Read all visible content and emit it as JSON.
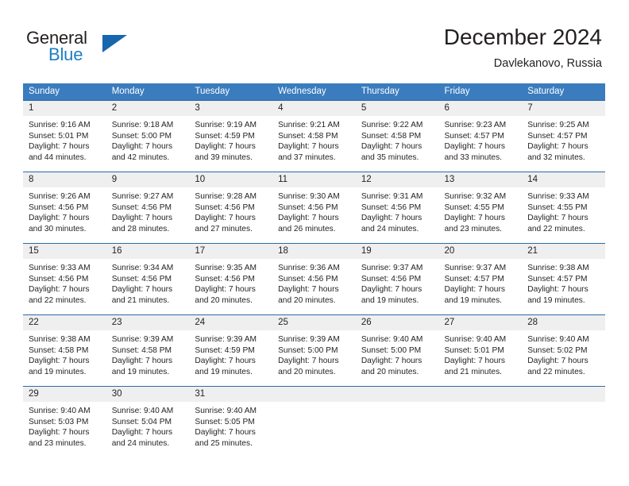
{
  "brand": {
    "name_top": "General",
    "name_bottom": "Blue",
    "triangle_icon": "blue-triangle-icon",
    "color_dark": "#231f20",
    "color_blue": "#1c7fc4"
  },
  "header": {
    "title": "December 2024",
    "subtitle": "Davlekanovo, Russia"
  },
  "theme": {
    "header_bg": "#3a7cbe",
    "header_text": "#ffffff",
    "row_divider": "#2a6ba8",
    "daynum_bg": "#efefef",
    "body_text": "#231f20"
  },
  "weekday_headers": [
    "Sunday",
    "Monday",
    "Tuesday",
    "Wednesday",
    "Thursday",
    "Friday",
    "Saturday"
  ],
  "weeks": [
    [
      {
        "day": "1",
        "sunrise": "Sunrise: 9:16 AM",
        "sunset": "Sunset: 5:01 PM",
        "daylight_1": "Daylight: 7 hours",
        "daylight_2": "and 44 minutes."
      },
      {
        "day": "2",
        "sunrise": "Sunrise: 9:18 AM",
        "sunset": "Sunset: 5:00 PM",
        "daylight_1": "Daylight: 7 hours",
        "daylight_2": "and 42 minutes."
      },
      {
        "day": "3",
        "sunrise": "Sunrise: 9:19 AM",
        "sunset": "Sunset: 4:59 PM",
        "daylight_1": "Daylight: 7 hours",
        "daylight_2": "and 39 minutes."
      },
      {
        "day": "4",
        "sunrise": "Sunrise: 9:21 AM",
        "sunset": "Sunset: 4:58 PM",
        "daylight_1": "Daylight: 7 hours",
        "daylight_2": "and 37 minutes."
      },
      {
        "day": "5",
        "sunrise": "Sunrise: 9:22 AM",
        "sunset": "Sunset: 4:58 PM",
        "daylight_1": "Daylight: 7 hours",
        "daylight_2": "and 35 minutes."
      },
      {
        "day": "6",
        "sunrise": "Sunrise: 9:23 AM",
        "sunset": "Sunset: 4:57 PM",
        "daylight_1": "Daylight: 7 hours",
        "daylight_2": "and 33 minutes."
      },
      {
        "day": "7",
        "sunrise": "Sunrise: 9:25 AM",
        "sunset": "Sunset: 4:57 PM",
        "daylight_1": "Daylight: 7 hours",
        "daylight_2": "and 32 minutes."
      }
    ],
    [
      {
        "day": "8",
        "sunrise": "Sunrise: 9:26 AM",
        "sunset": "Sunset: 4:56 PM",
        "daylight_1": "Daylight: 7 hours",
        "daylight_2": "and 30 minutes."
      },
      {
        "day": "9",
        "sunrise": "Sunrise: 9:27 AM",
        "sunset": "Sunset: 4:56 PM",
        "daylight_1": "Daylight: 7 hours",
        "daylight_2": "and 28 minutes."
      },
      {
        "day": "10",
        "sunrise": "Sunrise: 9:28 AM",
        "sunset": "Sunset: 4:56 PM",
        "daylight_1": "Daylight: 7 hours",
        "daylight_2": "and 27 minutes."
      },
      {
        "day": "11",
        "sunrise": "Sunrise: 9:30 AM",
        "sunset": "Sunset: 4:56 PM",
        "daylight_1": "Daylight: 7 hours",
        "daylight_2": "and 26 minutes."
      },
      {
        "day": "12",
        "sunrise": "Sunrise: 9:31 AM",
        "sunset": "Sunset: 4:56 PM",
        "daylight_1": "Daylight: 7 hours",
        "daylight_2": "and 24 minutes."
      },
      {
        "day": "13",
        "sunrise": "Sunrise: 9:32 AM",
        "sunset": "Sunset: 4:55 PM",
        "daylight_1": "Daylight: 7 hours",
        "daylight_2": "and 23 minutes."
      },
      {
        "day": "14",
        "sunrise": "Sunrise: 9:33 AM",
        "sunset": "Sunset: 4:55 PM",
        "daylight_1": "Daylight: 7 hours",
        "daylight_2": "and 22 minutes."
      }
    ],
    [
      {
        "day": "15",
        "sunrise": "Sunrise: 9:33 AM",
        "sunset": "Sunset: 4:56 PM",
        "daylight_1": "Daylight: 7 hours",
        "daylight_2": "and 22 minutes."
      },
      {
        "day": "16",
        "sunrise": "Sunrise: 9:34 AM",
        "sunset": "Sunset: 4:56 PM",
        "daylight_1": "Daylight: 7 hours",
        "daylight_2": "and 21 minutes."
      },
      {
        "day": "17",
        "sunrise": "Sunrise: 9:35 AM",
        "sunset": "Sunset: 4:56 PM",
        "daylight_1": "Daylight: 7 hours",
        "daylight_2": "and 20 minutes."
      },
      {
        "day": "18",
        "sunrise": "Sunrise: 9:36 AM",
        "sunset": "Sunset: 4:56 PM",
        "daylight_1": "Daylight: 7 hours",
        "daylight_2": "and 20 minutes."
      },
      {
        "day": "19",
        "sunrise": "Sunrise: 9:37 AM",
        "sunset": "Sunset: 4:56 PM",
        "daylight_1": "Daylight: 7 hours",
        "daylight_2": "and 19 minutes."
      },
      {
        "day": "20",
        "sunrise": "Sunrise: 9:37 AM",
        "sunset": "Sunset: 4:57 PM",
        "daylight_1": "Daylight: 7 hours",
        "daylight_2": "and 19 minutes."
      },
      {
        "day": "21",
        "sunrise": "Sunrise: 9:38 AM",
        "sunset": "Sunset: 4:57 PM",
        "daylight_1": "Daylight: 7 hours",
        "daylight_2": "and 19 minutes."
      }
    ],
    [
      {
        "day": "22",
        "sunrise": "Sunrise: 9:38 AM",
        "sunset": "Sunset: 4:58 PM",
        "daylight_1": "Daylight: 7 hours",
        "daylight_2": "and 19 minutes."
      },
      {
        "day": "23",
        "sunrise": "Sunrise: 9:39 AM",
        "sunset": "Sunset: 4:58 PM",
        "daylight_1": "Daylight: 7 hours",
        "daylight_2": "and 19 minutes."
      },
      {
        "day": "24",
        "sunrise": "Sunrise: 9:39 AM",
        "sunset": "Sunset: 4:59 PM",
        "daylight_1": "Daylight: 7 hours",
        "daylight_2": "and 19 minutes."
      },
      {
        "day": "25",
        "sunrise": "Sunrise: 9:39 AM",
        "sunset": "Sunset: 5:00 PM",
        "daylight_1": "Daylight: 7 hours",
        "daylight_2": "and 20 minutes."
      },
      {
        "day": "26",
        "sunrise": "Sunrise: 9:40 AM",
        "sunset": "Sunset: 5:00 PM",
        "daylight_1": "Daylight: 7 hours",
        "daylight_2": "and 20 minutes."
      },
      {
        "day": "27",
        "sunrise": "Sunrise: 9:40 AM",
        "sunset": "Sunset: 5:01 PM",
        "daylight_1": "Daylight: 7 hours",
        "daylight_2": "and 21 minutes."
      },
      {
        "day": "28",
        "sunrise": "Sunrise: 9:40 AM",
        "sunset": "Sunset: 5:02 PM",
        "daylight_1": "Daylight: 7 hours",
        "daylight_2": "and 22 minutes."
      }
    ],
    [
      {
        "day": "29",
        "sunrise": "Sunrise: 9:40 AM",
        "sunset": "Sunset: 5:03 PM",
        "daylight_1": "Daylight: 7 hours",
        "daylight_2": "and 23 minutes."
      },
      {
        "day": "30",
        "sunrise": "Sunrise: 9:40 AM",
        "sunset": "Sunset: 5:04 PM",
        "daylight_1": "Daylight: 7 hours",
        "daylight_2": "and 24 minutes."
      },
      {
        "day": "31",
        "sunrise": "Sunrise: 9:40 AM",
        "sunset": "Sunset: 5:05 PM",
        "daylight_1": "Daylight: 7 hours",
        "daylight_2": "and 25 minutes."
      },
      {
        "day": "",
        "sunrise": "",
        "sunset": "",
        "daylight_1": "",
        "daylight_2": ""
      },
      {
        "day": "",
        "sunrise": "",
        "sunset": "",
        "daylight_1": "",
        "daylight_2": ""
      },
      {
        "day": "",
        "sunrise": "",
        "sunset": "",
        "daylight_1": "",
        "daylight_2": ""
      },
      {
        "day": "",
        "sunrise": "",
        "sunset": "",
        "daylight_1": "",
        "daylight_2": ""
      }
    ]
  ]
}
